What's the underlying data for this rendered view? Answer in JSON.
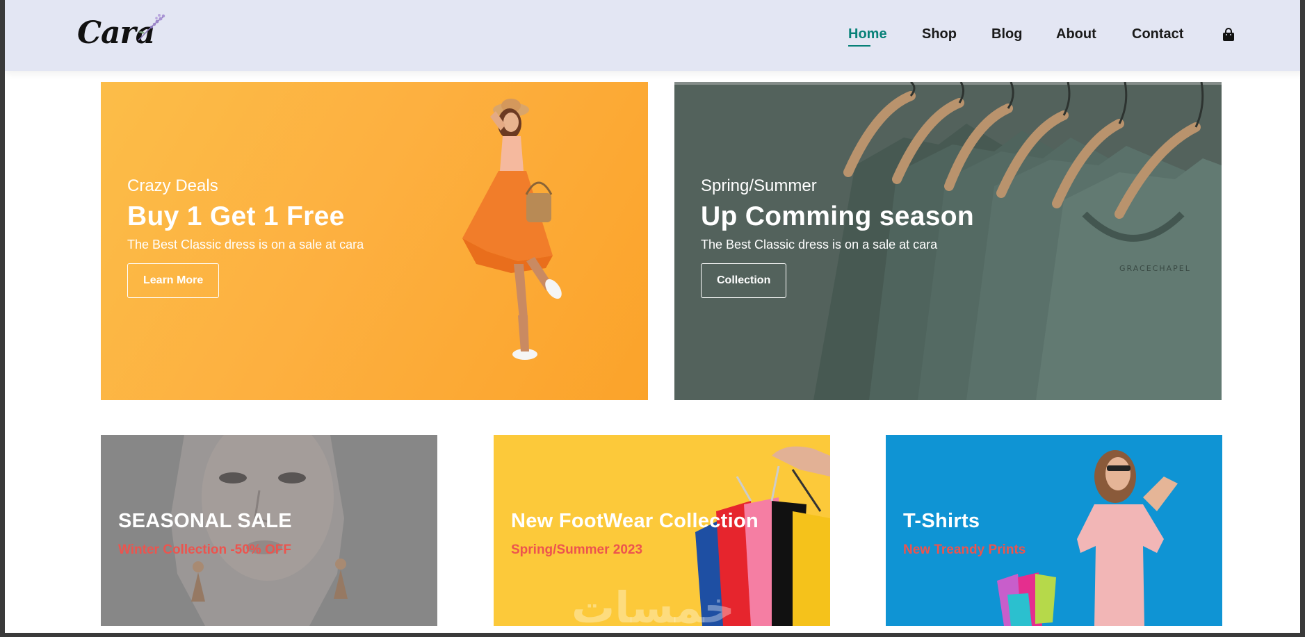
{
  "header": {
    "logo_text": "Cara",
    "nav": [
      {
        "label": "Home",
        "active": true
      },
      {
        "label": "Shop",
        "active": false
      },
      {
        "label": "Blog",
        "active": false
      },
      {
        "label": "About",
        "active": false
      },
      {
        "label": "Contact",
        "active": false
      }
    ],
    "cart_icon": "shopping-bag-icon",
    "accent_color": "#088178",
    "background_color": "#e3e6f3"
  },
  "banners": [
    {
      "kicker": "Crazy Deals",
      "title": "Buy 1 Get 1 Free",
      "subtitle": "The Best Classic dress is on a sale at cara",
      "button": "Learn More",
      "background_color": "#fdb040"
    },
    {
      "kicker": "Spring/Summer",
      "title": "Up Comming season",
      "subtitle": "The Best Classic dress is on a sale at cara",
      "button": "Collection",
      "background_color": "#5f716a"
    }
  ],
  "small_banners": [
    {
      "title": "SEASONAL SALE",
      "subtitle": "Winter Collection -50% OFF",
      "background_color": "#8d8d8d"
    },
    {
      "title": "New FootWear Collection",
      "subtitle": "Spring/Summer 2023",
      "background_color": "#fcc93a"
    },
    {
      "title": "T-Shirts",
      "subtitle": "New Treandy Prints",
      "background_color": "#0f94d4"
    }
  ],
  "subtitle_color": "#ec544e",
  "watermark": "خمسات"
}
